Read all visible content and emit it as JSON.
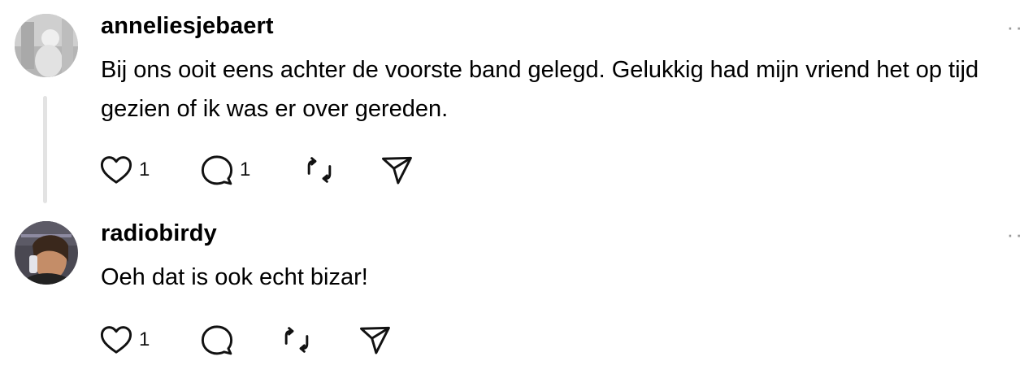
{
  "comments": [
    {
      "username": "anneliesjebaert",
      "text": "Bij ons ooit eens achter de voorste band gelegd. Gelukkig had mijn vriend het op tijd gezien of ik was er over gereden.",
      "likes": "1",
      "replies": "1",
      "more_label": "··"
    },
    {
      "username": "radiobirdy",
      "text": "Oeh dat is ook echt bizar!",
      "likes": "1",
      "more_label": "··"
    }
  ],
  "icons": {
    "like": "heart-icon",
    "reply": "comment-icon",
    "repost": "repost-icon",
    "share": "send-icon"
  }
}
